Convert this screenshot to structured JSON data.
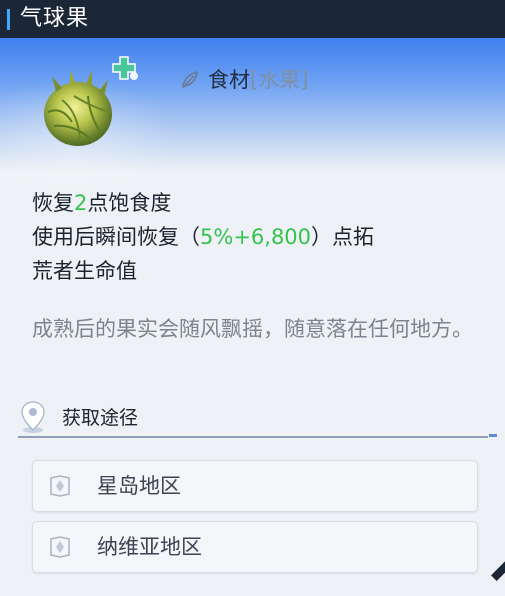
{
  "header": {
    "title": "气球果"
  },
  "item": {
    "icon": "balloon-fruit-icon",
    "badge_icon": "plus-heal-icon",
    "category": "食材",
    "subcategory": "[水果]",
    "category_icon": "leaf-food-icon"
  },
  "effects": {
    "line1_prefix": "恢复",
    "line1_value": "2",
    "line1_suffix": "点饱食度",
    "line2_prefix": "使用后瞬间恢复（",
    "line2_value": "5%+6,800",
    "line2_suffix": "）点拓",
    "line3": "荒者生命值"
  },
  "description": "成熟后的果实会随风飘摇，随意落在任何地方。",
  "source": {
    "title": "获取途径",
    "icon": "location-pin-icon",
    "items": [
      {
        "label": "星岛地区",
        "icon": "map-region-icon"
      },
      {
        "label": "纳维亚地区",
        "icon": "map-region-icon"
      }
    ]
  },
  "colors": {
    "accent": "#3ea7ff",
    "value_green": "#35c24e",
    "header_bg": "#1b2636"
  }
}
